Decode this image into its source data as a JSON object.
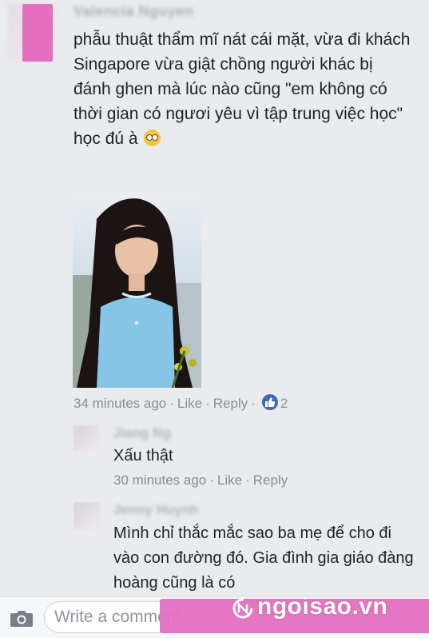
{
  "main_comment": {
    "author": "Valencia Nguyen",
    "text": "phẫu thuật thẩm mĩ nát cái mặt, vừa đi khách Singapore vừa giật chồng người khác bị đánh ghen mà lúc nào cũng \"em không có thời gian có ngươi yêu vì tập trung việc học\" học đú à",
    "emoji": "flushed-face-icon",
    "time": "34 minutes ago",
    "like_label": "Like",
    "reply_label": "Reply",
    "like_count": "2",
    "sep": "·"
  },
  "replies": [
    {
      "author": "Jiang Ng",
      "text": "Xấu thật",
      "time": "30 minutes ago",
      "like_label": "Like",
      "reply_label": "Reply"
    },
    {
      "author": "Jenny Huynh",
      "text": "Mình chỉ thắc mắc sao ba mẹ để cho đi vào con đường đó. Gia đình gia giáo đàng hoàng cũng là có"
    }
  ],
  "composer": {
    "placeholder": "Write a comment..."
  },
  "watermark": {
    "text": "ngoisao.vn"
  },
  "colors": {
    "accent_blue": "#4267b2",
    "watermark_pink": "#e46fc0"
  }
}
